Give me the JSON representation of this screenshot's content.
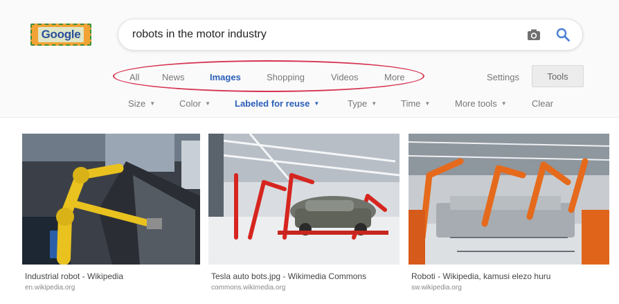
{
  "logo": {
    "text": "Google"
  },
  "search": {
    "query": "robots in the motor industry"
  },
  "icons": {
    "camera": "camera-icon",
    "search": "magnifier-icon"
  },
  "tabs": [
    {
      "label": "All"
    },
    {
      "label": "News"
    },
    {
      "label": "Images",
      "active": true
    },
    {
      "label": "Shopping"
    },
    {
      "label": "Videos"
    },
    {
      "label": "More"
    }
  ],
  "settings_label": "Settings",
  "tools_label": "Tools",
  "filters": [
    {
      "label": "Size"
    },
    {
      "label": "Color"
    },
    {
      "label": "Labeled for reuse",
      "selected": true
    },
    {
      "label": "Type"
    },
    {
      "label": "Time"
    },
    {
      "label": "More tools"
    }
  ],
  "clear_label": "Clear",
  "results": [
    {
      "title": "Industrial robot - Wikipedia",
      "source": "en.wikipedia.org"
    },
    {
      "title": "Tesla auto bots.jpg - Wikimedia Commons",
      "source": "commons.wikimedia.org"
    },
    {
      "title": "Roboti - Wikipedia, kamusi elezo huru",
      "source": "sw.wikipedia.org"
    }
  ],
  "colors": {
    "accent": "#2a5fb8",
    "highlight_oval": "#d63350",
    "logo_bg": "#f3a335"
  }
}
